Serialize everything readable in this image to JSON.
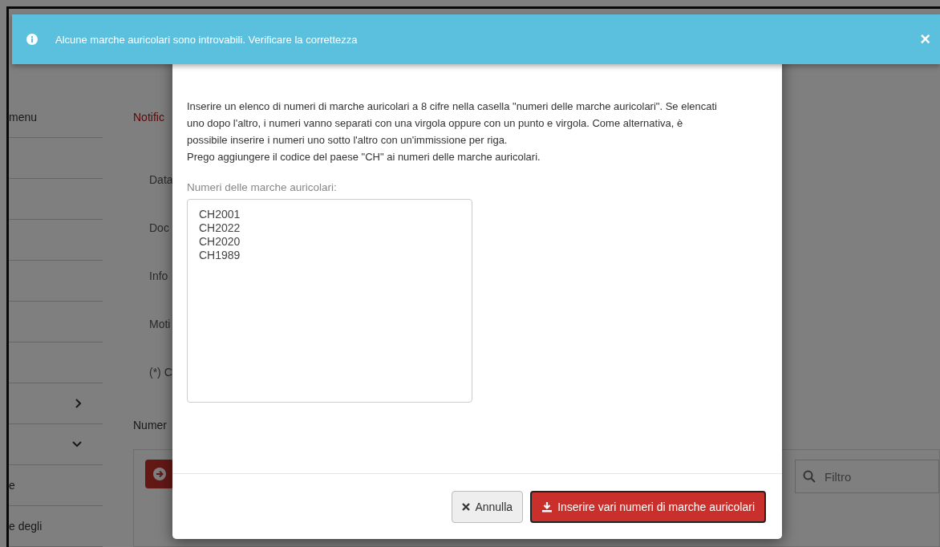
{
  "alert": {
    "message": "Alcune marche auricolari sono introvabili. Verificare la correttezza",
    "close": "×"
  },
  "sidebar": {
    "items": [
      {
        "label": "menu",
        "kind": "text"
      },
      {
        "kind": "blank"
      },
      {
        "kind": "blank"
      },
      {
        "kind": "blank"
      },
      {
        "kind": "blank"
      },
      {
        "kind": "blank"
      },
      {
        "kind": "blank"
      },
      {
        "kind": "collapsed"
      },
      {
        "kind": "expanded"
      },
      {
        "label": "e",
        "kind": "text"
      },
      {
        "label": "e degli",
        "kind": "text"
      }
    ]
  },
  "page": {
    "heading": "Notific",
    "fields": [
      "Data",
      "Doc",
      "Info",
      "Moti"
    ],
    "required_note": "(*) C",
    "section": "Numer",
    "filter": {
      "placeholder": "Filtro"
    }
  },
  "modal": {
    "description": [
      "Inserire un elenco di numeri di marche auricolari a 8 cifre nella casella \"numeri delle marche auricolari\". Se elencati uno dopo l'altro, i numeri vanno separati con una virgola oppure con un punto e virgola. Come alternativa, è possibile inserire i numeri uno sotto l'altro con un'immissione per riga.",
      "Prego aggiungere il codice del paese \"CH\" ai numeri delle marche auricolari."
    ],
    "field_label": "Numeri delle marche auricolari:",
    "field_value": [
      "CH2001",
      "CH2022",
      "CH2020",
      "CH1989"
    ],
    "buttons": [
      {
        "label": "Annulla",
        "kind": "cancel"
      },
      {
        "label": "Inserire vari numeri di marche auricolari",
        "kind": "primary"
      }
    ]
  }
}
